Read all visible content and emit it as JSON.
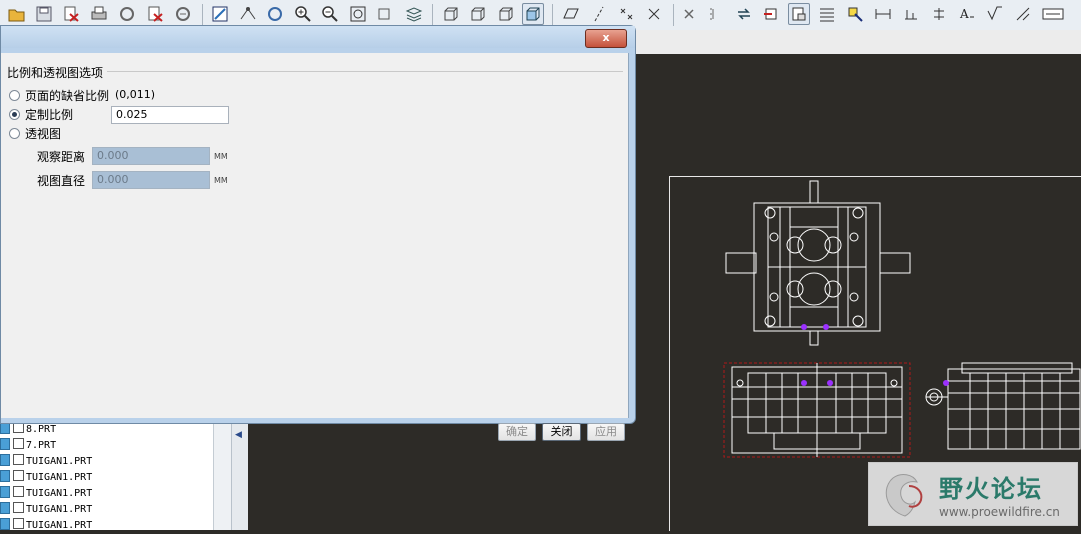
{
  "dialog": {
    "close_label": "x",
    "group_title": "比例和透视图选项",
    "options": [
      {
        "label": "页面的缺省比例",
        "value": "(0,011)",
        "checked": false
      },
      {
        "label": "定制比例",
        "value": "0.025",
        "checked": true
      },
      {
        "label": "透视图",
        "checked": false
      }
    ],
    "fields": [
      {
        "label": "观察距离",
        "value": "0.000",
        "unit": "MM"
      },
      {
        "label": "视图直径",
        "value": "0.000",
        "unit": "MM"
      }
    ],
    "buttons": {
      "ok": "确定",
      "close": "关闭",
      "apply": "应用"
    }
  },
  "tree": {
    "items": [
      "8.PRT",
      "7.PRT",
      "TUIGAN1.PRT",
      "TUIGAN1.PRT",
      "TUIGAN1.PRT",
      "TUIGAN1.PRT",
      "TUIGAN1.PRT"
    ]
  },
  "watermark": {
    "title": "野火论坛",
    "url": "www.proewildfire.cn"
  },
  "colors": {
    "canvas": "#2d2b27",
    "dialog_frame": "#b9d1ea",
    "close_button": "#c4513a",
    "drawing_line": "#ffffff",
    "highlight": "#b01818",
    "purple": "#9b30ff"
  }
}
